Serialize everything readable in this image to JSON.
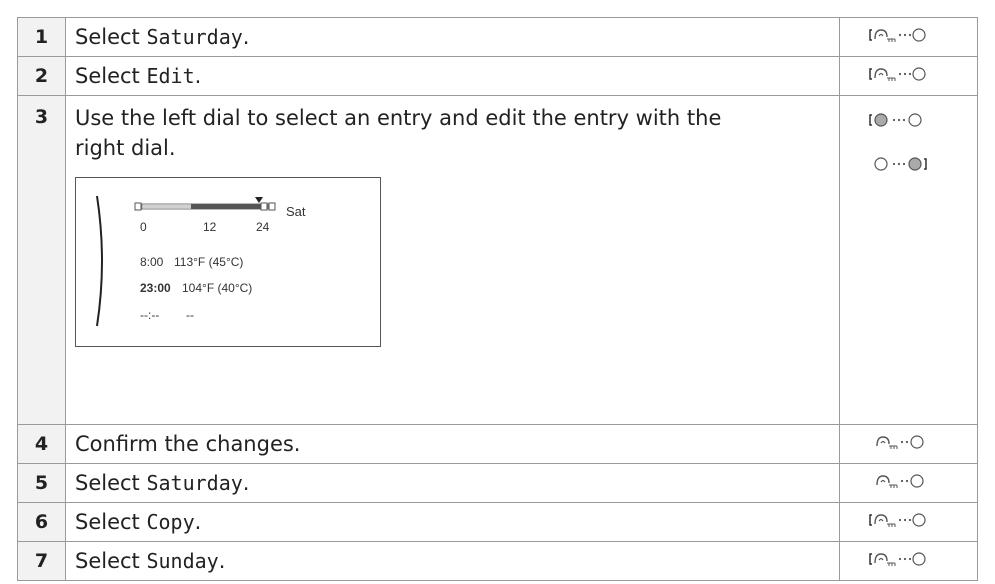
{
  "steps": [
    {
      "num": "1",
      "pre": "Select ",
      "code": "Saturday",
      "post": "."
    },
    {
      "num": "2",
      "pre": "Select ",
      "code": "Edit",
      "post": "."
    },
    {
      "num": "3",
      "line1": "Use the left dial to select an entry and edit the entry with the",
      "line2": "right dial."
    },
    {
      "num": "4",
      "text": "Confirm the changes."
    },
    {
      "num": "5",
      "pre": "Select ",
      "code": "Saturday",
      "post": "."
    },
    {
      "num": "6",
      "pre": "Select ",
      "code": "Copy",
      "post": "."
    },
    {
      "num": "7",
      "pre": "Select ",
      "code": "Sunday",
      "post": "."
    }
  ],
  "screen": {
    "day": "Sat",
    "ticks": [
      "0",
      "12",
      "24"
    ],
    "entries": [
      {
        "time": "8:00",
        "temp": "113°F (45°C)"
      },
      {
        "time": "23:00",
        "temp": "104°F (40°C)"
      },
      {
        "time": "--:--",
        "temp": "--"
      }
    ]
  },
  "icons": {
    "dial_left_press_rotate": "left-dial-press-rotate-icon",
    "dial_left_press": "left-dial-press-icon",
    "dial_left_rotate": "left-dial-rotate-icon",
    "dial_right_rotate": "right-dial-rotate-icon"
  },
  "colors": {
    "border": "#9a9a9a",
    "num_bg": "#f2f2f2",
    "bar_dark": "#555555",
    "bar_light": "#d0d0d0"
  }
}
